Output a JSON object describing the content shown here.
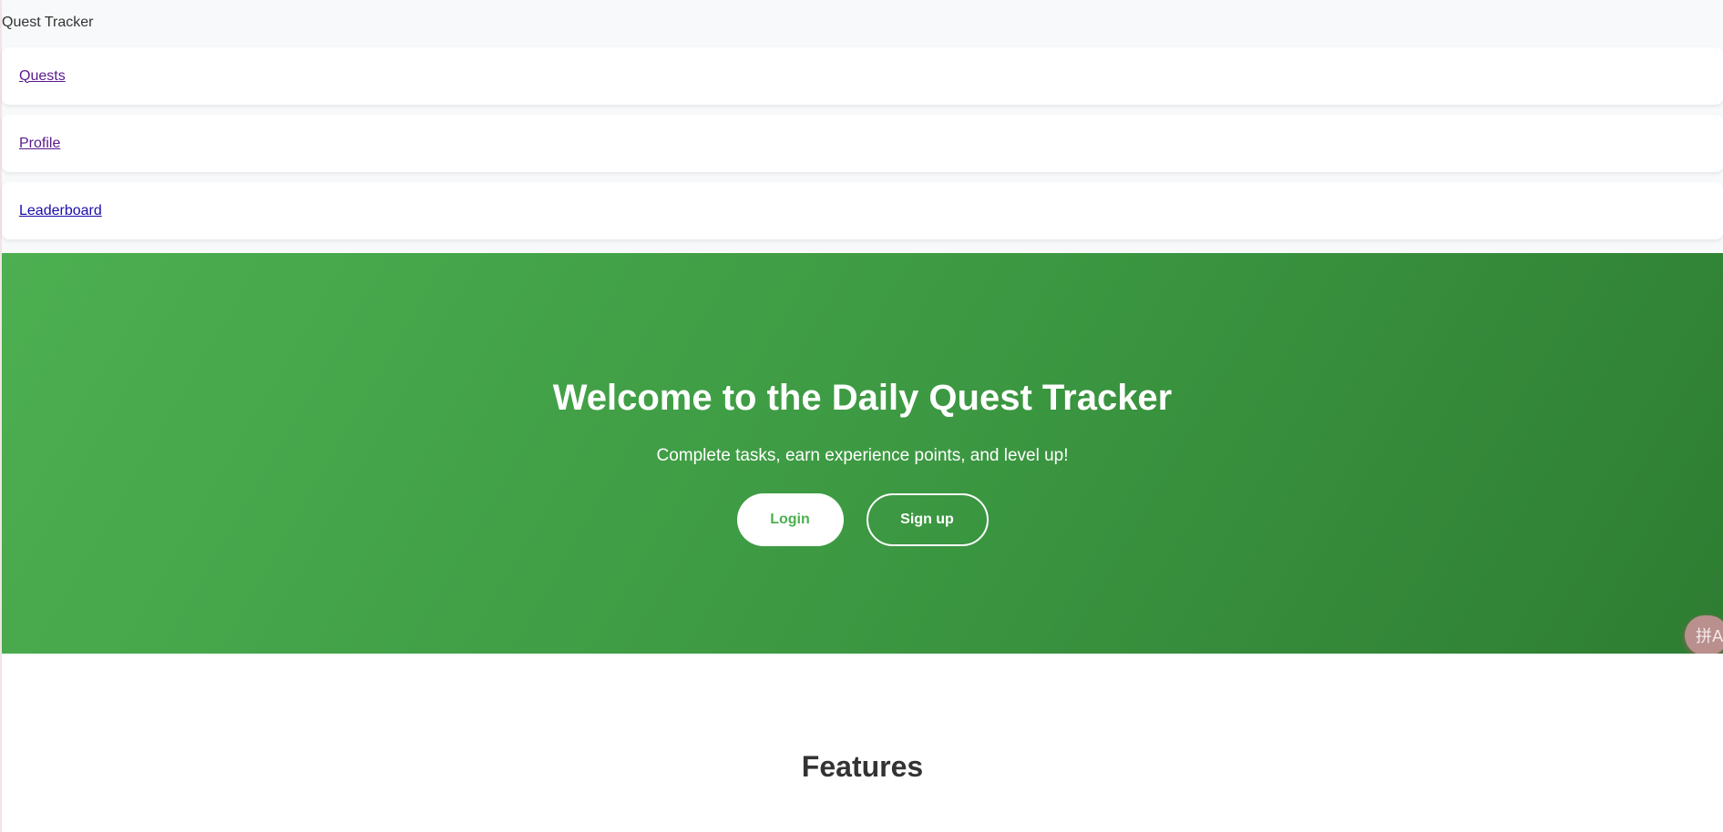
{
  "app": {
    "brand": "Quest Tracker"
  },
  "nav": {
    "items": [
      {
        "label": "Quests"
      },
      {
        "label": "Profile"
      },
      {
        "label": "Leaderboard"
      }
    ]
  },
  "hero": {
    "title": "Welcome to the Daily Quest Tracker",
    "subtitle": "Complete tasks, earn experience points, and level up!",
    "login_label": "Login",
    "signup_label": "Sign up"
  },
  "features": {
    "title": "Features"
  },
  "translate_widget": {
    "icon": "translate-icon",
    "glyph": "拼A"
  },
  "colors": {
    "accent": "#4caf50",
    "accent_dark": "#2e7d32",
    "link_visited": "#5a1a8c",
    "link": "#1a0dab"
  }
}
